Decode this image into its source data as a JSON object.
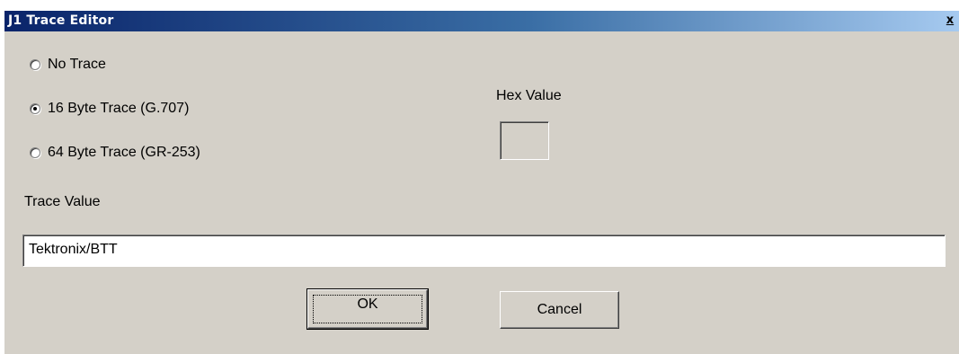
{
  "window": {
    "title": "J1 Trace Editor",
    "close_label": "x"
  },
  "trace_options": [
    {
      "label": "No Trace",
      "selected": false
    },
    {
      "label": "16 Byte Trace (G.707)",
      "selected": true
    },
    {
      "label": "64 Byte Trace (GR-253)",
      "selected": false
    }
  ],
  "hex": {
    "label": "Hex Value",
    "value": ""
  },
  "trace": {
    "label": "Trace Value",
    "value": "Tektronix/BTT"
  },
  "buttons": {
    "ok_label": "OK",
    "cancel_label": "Cancel"
  },
  "colors": {
    "dialog_face": "#d4d0c8",
    "titlebar_start": "#0a246a",
    "titlebar_end": "#a6caf0"
  }
}
